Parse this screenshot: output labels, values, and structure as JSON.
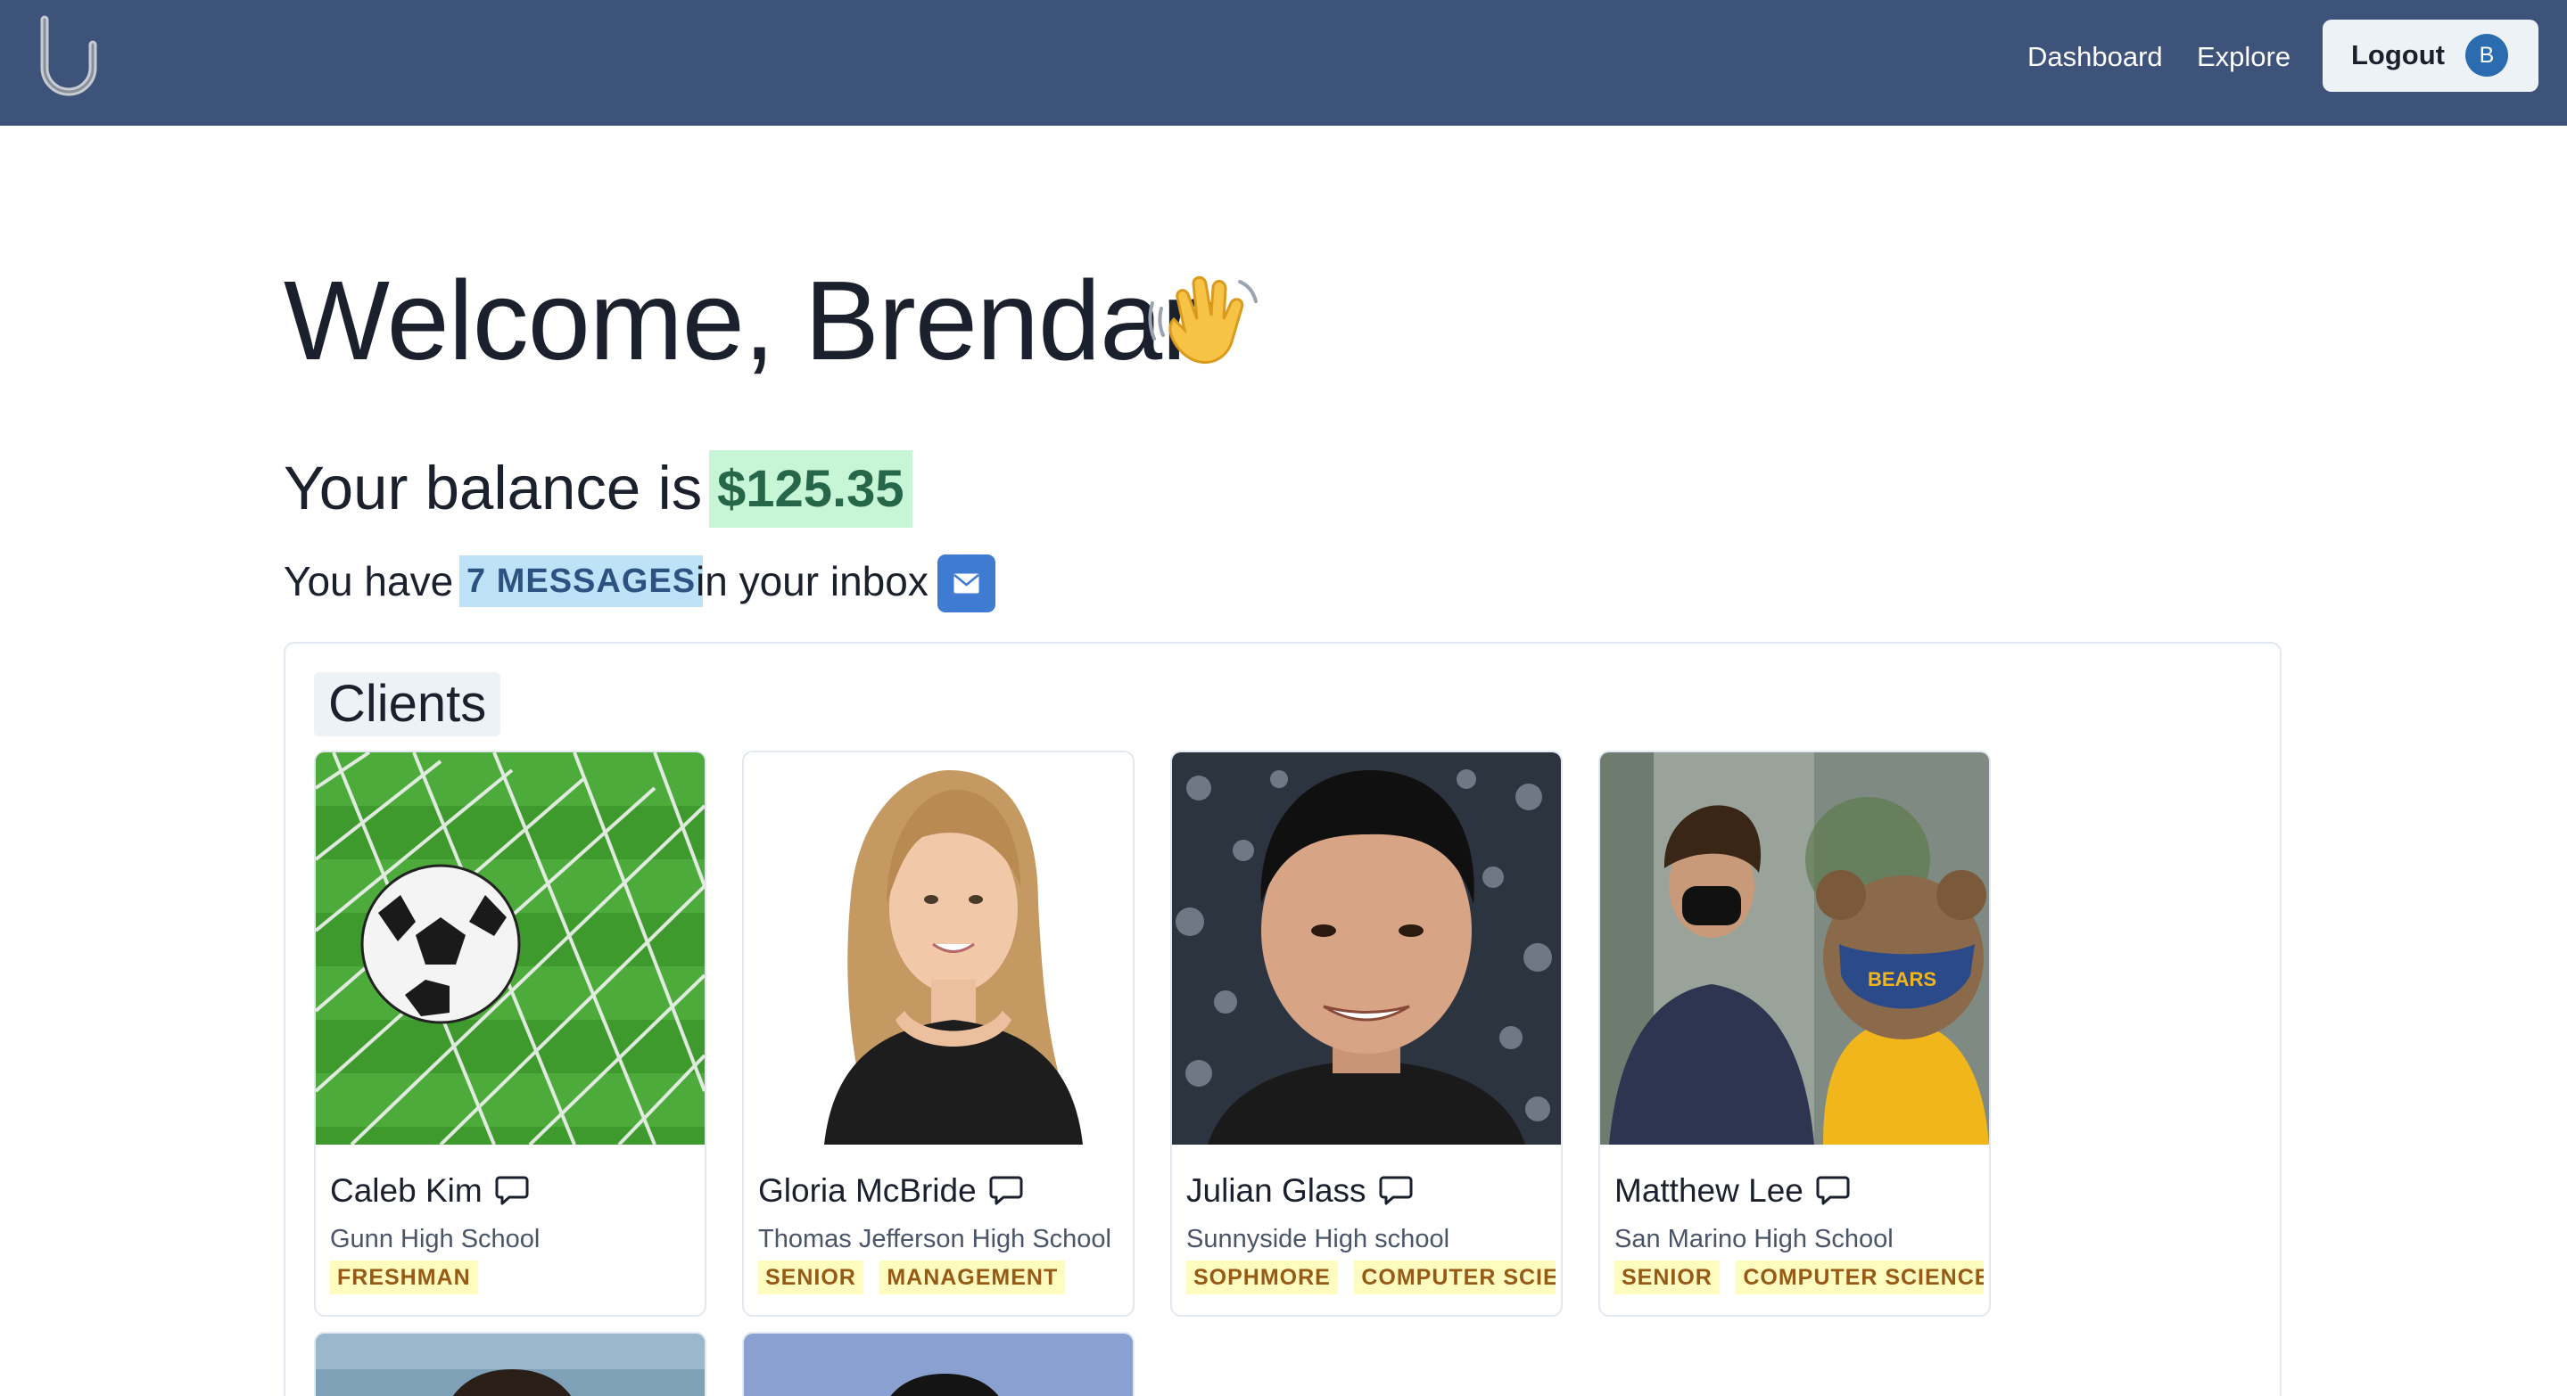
{
  "nav": {
    "links": [
      "Dashboard",
      "Explore"
    ],
    "logout_label": "Logout",
    "avatar_initial": "B"
  },
  "welcome": {
    "heading": "Welcome, Brendan",
    "emoji": "waving-hand-icon"
  },
  "balance": {
    "prefix": "Your balance is",
    "amount": "$125.35"
  },
  "inbox": {
    "prefix": "You have",
    "count_label": "7 MESSAGES",
    "suffix": "in your inbox",
    "icon": "mail-icon"
  },
  "clients": {
    "heading": "Clients",
    "cards": [
      {
        "name": "Caleb Kim",
        "school": "Gunn High School",
        "tags": [
          "FRESHMAN"
        ],
        "photo": "soccer-ball-in-net"
      },
      {
        "name": "Gloria McBride",
        "school": "Thomas Jefferson High School",
        "tags": [
          "SENIOR",
          "MANAGEMENT"
        ],
        "photo": "portrait"
      },
      {
        "name": "Julian Glass",
        "school": "Sunnyside High school",
        "tags": [
          "SOPHMORE",
          "COMPUTER SCIENCE"
        ],
        "photo": "portrait"
      },
      {
        "name": "Matthew Lee",
        "school": "San Marino High School",
        "tags": [
          "SENIOR",
          "COMPUTER SCIENCE"
        ],
        "photo": "portrait-with-mascot"
      }
    ]
  },
  "colors": {
    "navbar": "#3d537a",
    "balance_bg": "#c6f6d5",
    "balance_text": "#276749",
    "inbox_badge_bg": "#bee3f8",
    "mail_button": "#3f7bd1",
    "tag_bg": "#fefcbf",
    "tag_text": "#975a16"
  }
}
